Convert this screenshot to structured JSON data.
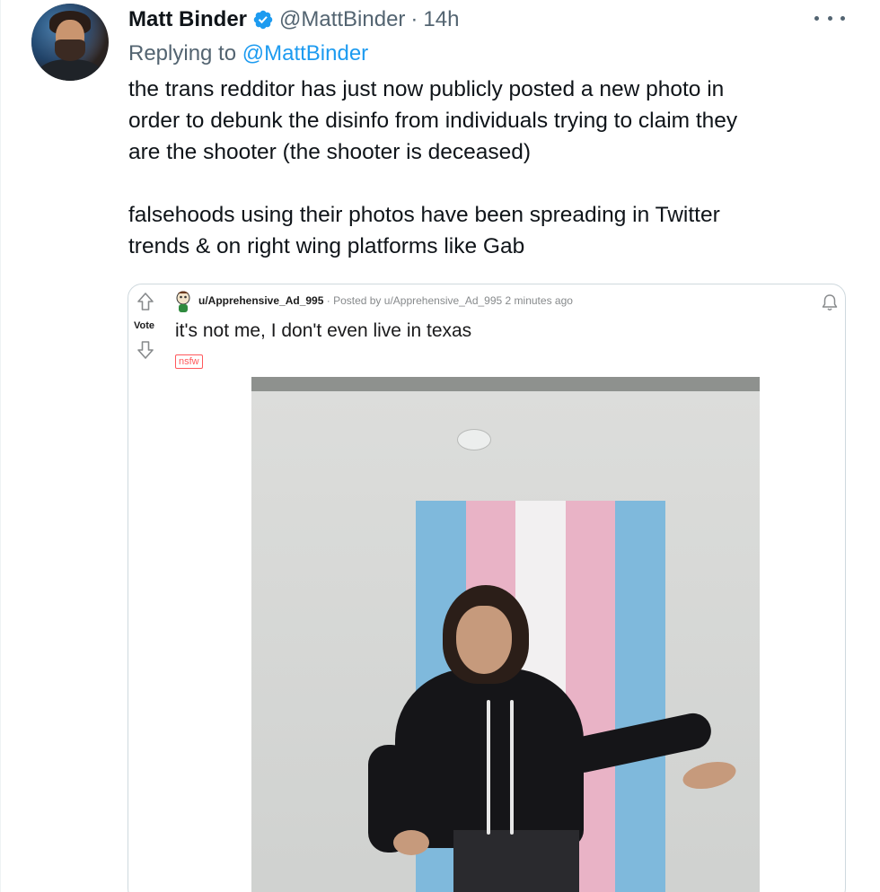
{
  "tweet": {
    "author_name": "Matt Binder",
    "handle": "@MattBinder",
    "separator": "·",
    "time": "14h",
    "replying_prefix": "Replying to",
    "replying_to": "@MattBinder",
    "lines": [
      "the trans redditor has just now publicly posted a new photo in",
      "order to debunk the disinfo from individuals trying to claim they",
      "are the shooter (the shooter is deceased)",
      "",
      "falsehoods using their photos have been spreading in Twitter",
      "trends & on right wing platforms like Gab"
    ],
    "verified_color": "#1d9bf0",
    "link_color": "#1d9bf0"
  },
  "reddit_card": {
    "vote_label": "Vote",
    "username": "u/Apprehensive_Ad_995",
    "meta": "· Posted by u/Apprehensive_Ad_995 2 minutes ago",
    "title": "it's not me, I don't even live in texas",
    "nsfw_tag": "nsfw",
    "icons": [
      "upvote-arrow-icon",
      "downvote-arrow-icon",
      "notification-bell-icon"
    ]
  }
}
